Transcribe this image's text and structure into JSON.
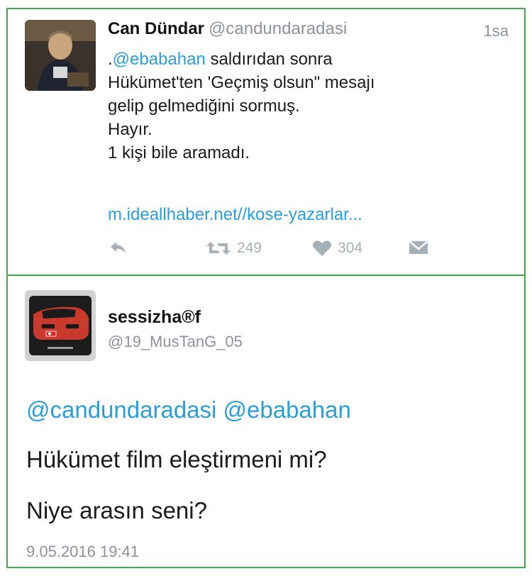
{
  "tweet": {
    "author_name": "Can Dündar",
    "author_handle": "@candundaradasi",
    "time": "1sa",
    "text_prefix": ".",
    "mention": "@ebabahan",
    "line1_rest": " saldırıdan sonra",
    "line2": "Hükümet'ten 'Geçmiş olsun\" mesajı",
    "line3": "gelip gelmediğini sormuş.",
    "line4": "Hayır.",
    "line5": "1 kişi bile aramadı.",
    "link": "m.ideallhaber.net//kose-yazarlar...",
    "retweet_count": "249",
    "like_count": "304",
    "icons": {
      "reply": "reply-icon",
      "retweet": "retweet-icon",
      "like": "heart-icon",
      "dm": "envelope-icon"
    }
  },
  "reply": {
    "author_name": "sessizha®f",
    "author_handle": "@19_MusTanG_05",
    "mentions": "@candundaradasi @ebabahan",
    "line1": "Hükümet film eleştirmeni mi?",
    "line2": "Niye arasın seni?",
    "date": "9.05.2016 19:41"
  },
  "colors": {
    "border": "#3fae49",
    "link": "#2a9ed8",
    "muted": "#8b939b",
    "action": "#a7b0b7"
  }
}
